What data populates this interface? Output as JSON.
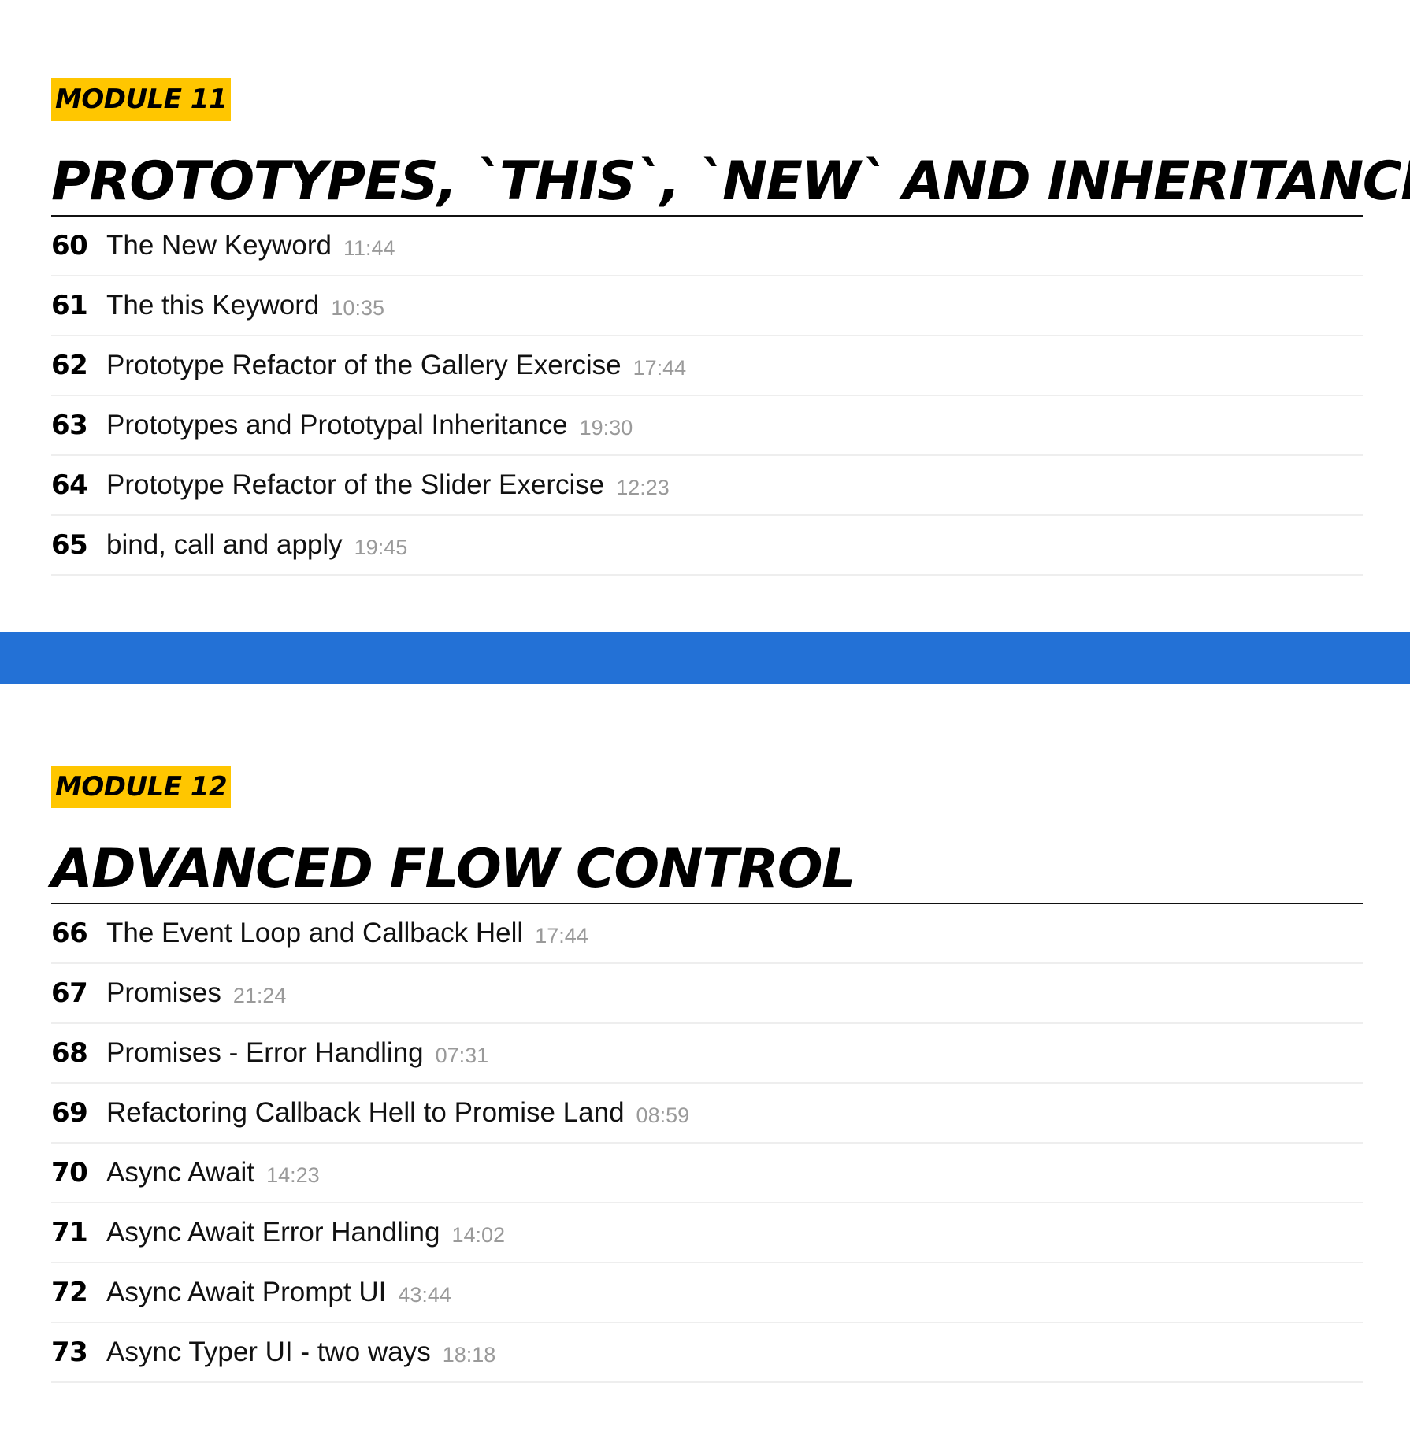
{
  "colors": {
    "badge_background": "#ffc600",
    "divider_band": "#2371d6",
    "duration_text": "#9a9a9a",
    "row_separator": "#eeeeee"
  },
  "modules": [
    {
      "badge": "MODULE 11",
      "title": "PROTOTYPES, `THIS`, `NEW` AND INHERITANCE",
      "lessons": [
        {
          "number": "60",
          "title": "The New Keyword",
          "duration": "11:44"
        },
        {
          "number": "61",
          "title": "The this Keyword",
          "duration": "10:35"
        },
        {
          "number": "62",
          "title": "Prototype Refactor of the Gallery Exercise",
          "duration": "17:44"
        },
        {
          "number": "63",
          "title": "Prototypes and Prototypal Inheritance",
          "duration": "19:30"
        },
        {
          "number": "64",
          "title": "Prototype Refactor of the Slider Exercise",
          "duration": "12:23"
        },
        {
          "number": "65",
          "title": "bind, call and apply",
          "duration": "19:45"
        }
      ]
    },
    {
      "badge": "MODULE 12",
      "title": "ADVANCED FLOW CONTROL",
      "lessons": [
        {
          "number": "66",
          "title": "The Event Loop and Callback Hell",
          "duration": "17:44"
        },
        {
          "number": "67",
          "title": "Promises",
          "duration": "21:24"
        },
        {
          "number": "68",
          "title": "Promises - Error Handling",
          "duration": "07:31"
        },
        {
          "number": "69",
          "title": "Refactoring Callback Hell to Promise Land",
          "duration": "08:59"
        },
        {
          "number": "70",
          "title": "Async Await",
          "duration": "14:23"
        },
        {
          "number": "71",
          "title": "Async Await Error Handling",
          "duration": "14:02"
        },
        {
          "number": "72",
          "title": "Async Await Prompt UI",
          "duration": "43:44"
        },
        {
          "number": "73",
          "title": "Async Typer UI - two ways",
          "duration": "18:18"
        }
      ]
    }
  ]
}
